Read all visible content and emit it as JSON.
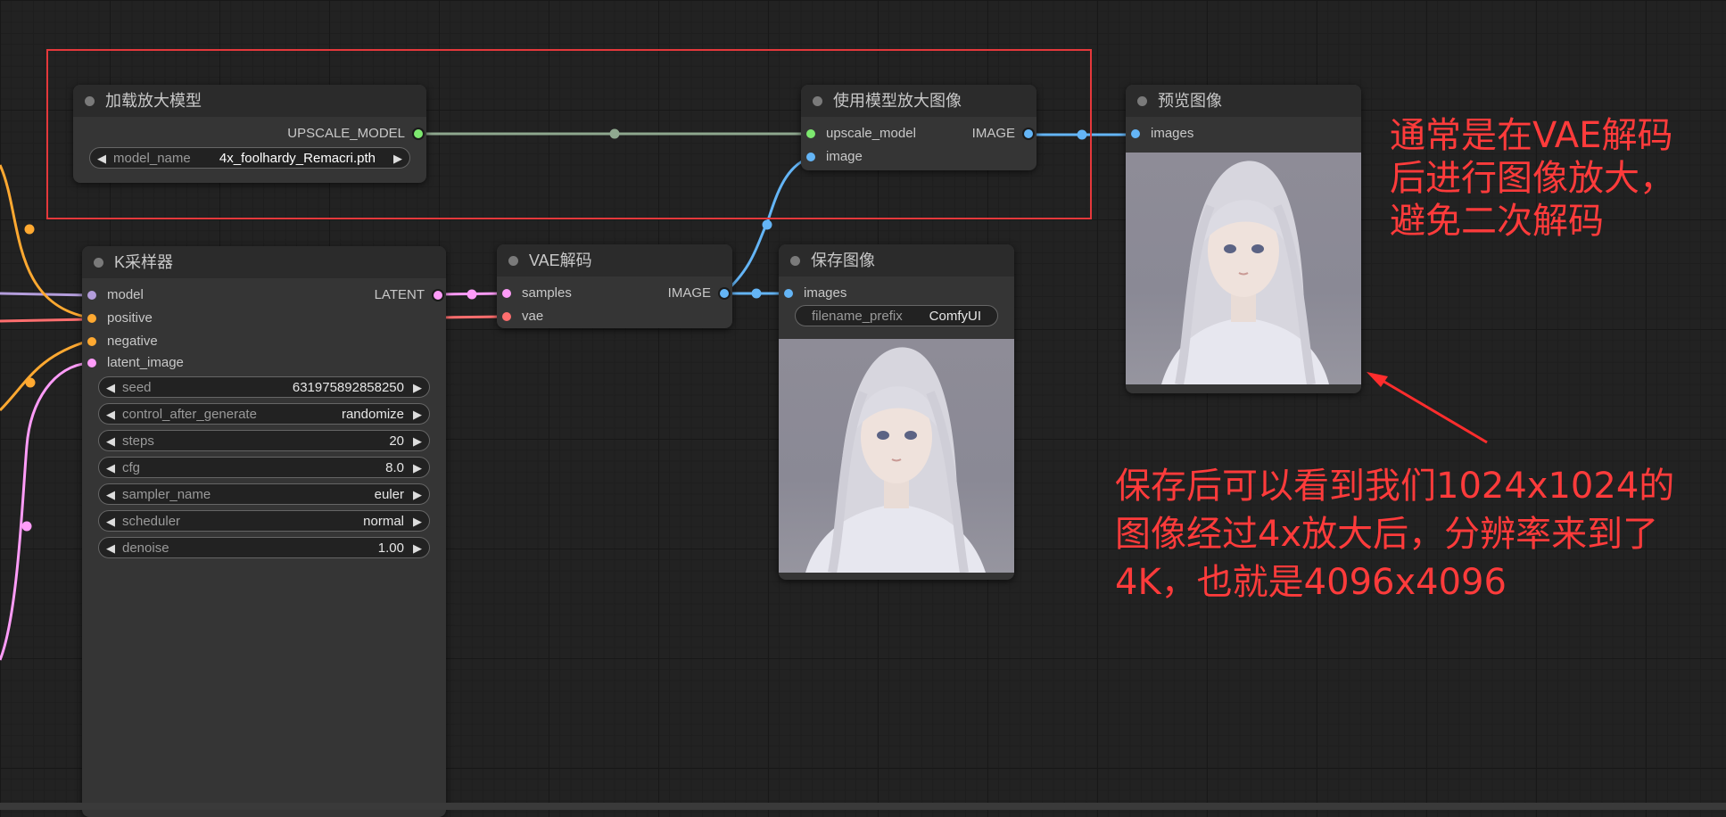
{
  "nodes": {
    "upscale_loader": {
      "title": "加载放大模型",
      "output_label": "UPSCALE_MODEL",
      "widget": {
        "label": "model_name",
        "value": "4x_foolhardy_Remacri.pth"
      }
    },
    "upscale_apply": {
      "title": "使用模型放大图像",
      "inputs": [
        "upscale_model",
        "image"
      ],
      "output_label": "IMAGE"
    },
    "preview": {
      "title": "预览图像",
      "input_label": "images"
    },
    "ksampler": {
      "title": "K采样器",
      "inputs": [
        "model",
        "positive",
        "negative",
        "latent_image"
      ],
      "output_label": "LATENT",
      "widgets": [
        {
          "label": "seed",
          "value": "631975892858250"
        },
        {
          "label": "control_after_generate",
          "value": "randomize"
        },
        {
          "label": "steps",
          "value": "20"
        },
        {
          "label": "cfg",
          "value": "8.0"
        },
        {
          "label": "sampler_name",
          "value": "euler"
        },
        {
          "label": "scheduler",
          "value": "normal"
        },
        {
          "label": "denoise",
          "value": "1.00"
        }
      ]
    },
    "vae_decode": {
      "title": "VAE解码",
      "inputs": [
        "samples",
        "vae"
      ],
      "output_label": "IMAGE"
    },
    "save": {
      "title": "保存图像",
      "input_label": "images",
      "widget": {
        "label": "filename_prefix",
        "value": "ComfyUI"
      }
    }
  },
  "annotations": {
    "top_lines": [
      "通常是在VAE解码",
      "后进行图像放大，",
      "避免二次解码"
    ],
    "bottom_lines": [
      "保存后可以看到我们1024x1024的",
      "图像经过4x放大后，分辨率来到了",
      "4K，也就是4096x4096"
    ]
  },
  "colors": {
    "background": "#222222",
    "node_body": "#353535",
    "node_header": "#2b2b2b",
    "annotation_red": "#ff3b3b",
    "group_frame": "#e5383b",
    "wire_upscale_model": "#8fa88f",
    "wire_image": "#64b5f6",
    "wire_latent": "#ff9cf9",
    "wire_model": "#b39ddb",
    "wire_conditioning": "#ffa931",
    "wire_vae": "#ff6e6e",
    "pin_upscale_model": "#7de86f"
  },
  "icons": [
    "node-collapse-dot",
    "triangle-left-icon",
    "triangle-right-icon",
    "arrow-annotation"
  ]
}
